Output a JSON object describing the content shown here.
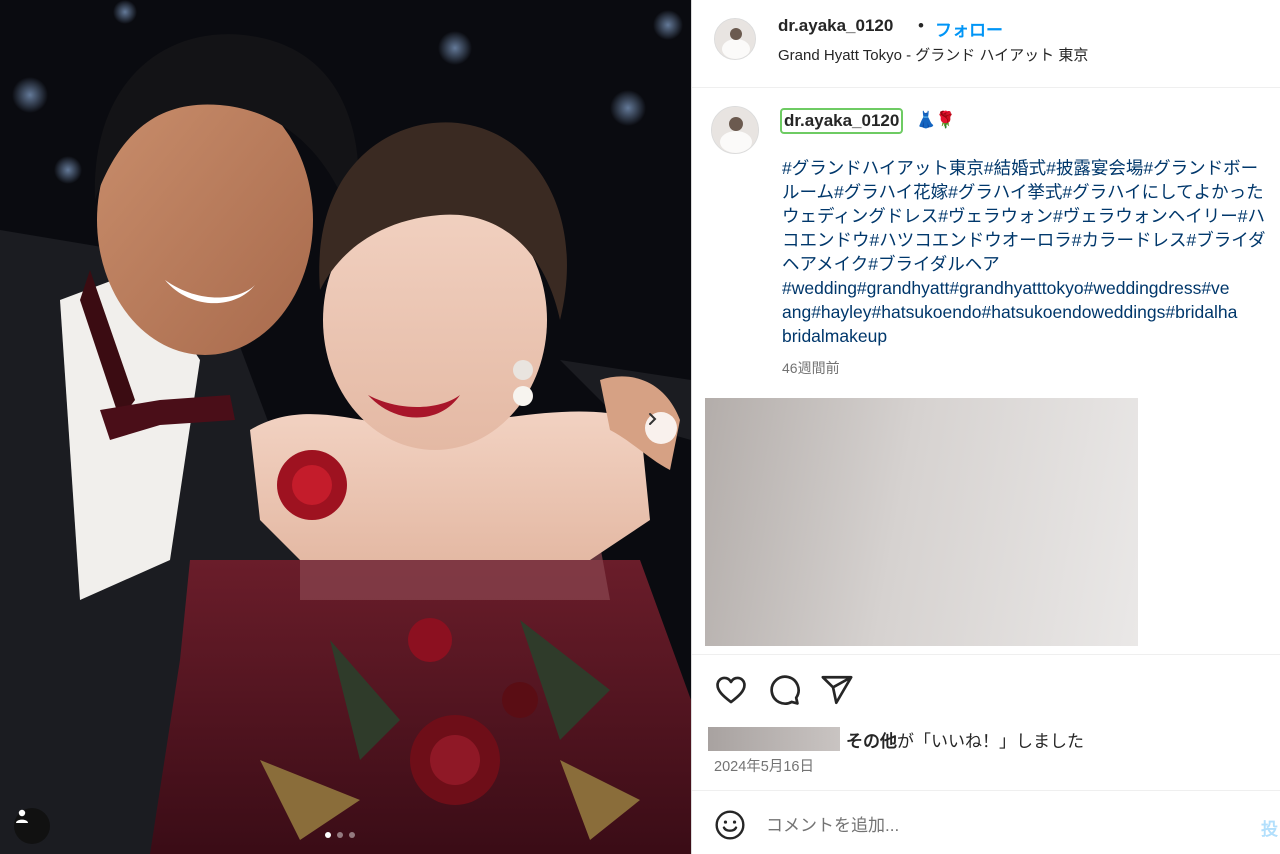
{
  "post": {
    "username": "dr.ayaka_0120",
    "dot": "•",
    "follow_label": "フォロー",
    "location": "Grand Hyatt Tokyo - グランド ハイアット 東京"
  },
  "caption": {
    "username": "dr.ayaka_0120",
    "emoji": "👗🌹",
    "lines": [
      "#グランドハイアット東京#結婚式#披露宴会場#グランドボー",
      "ルーム#グラハイ花嫁#グラハイ挙式#グラハイにしてよかった",
      "ウェディングドレス#ヴェラウォン#ヴェラウォンヘイリー#ハ",
      "コエンドウ#ハツコエンドウオーロラ#カラードレス#ブライダ",
      "ヘアメイク#ブライダルヘア",
      "#wedding#grandhyatt#grandhyatttokyo#weddingdress#ve",
      "ang#hayley#hatsukoendo#hatsukoendoweddings#bridalha",
      "bridalmakeup"
    ],
    "time_ago": "46週間前"
  },
  "actions": {
    "like_icon": "heart-icon",
    "comment_icon": "comment-icon",
    "share_icon": "share-icon",
    "likes_bold": "その他",
    "likes_rest": "が「いいね！」しました",
    "date": "2024年5月16日"
  },
  "comment": {
    "placeholder": "コメントを追加...",
    "post_label": "投"
  },
  "colors": {
    "link": "#0095f6",
    "hashtag": "#00376b",
    "muted": "#737373",
    "highlight_border": "#6ecb63"
  }
}
